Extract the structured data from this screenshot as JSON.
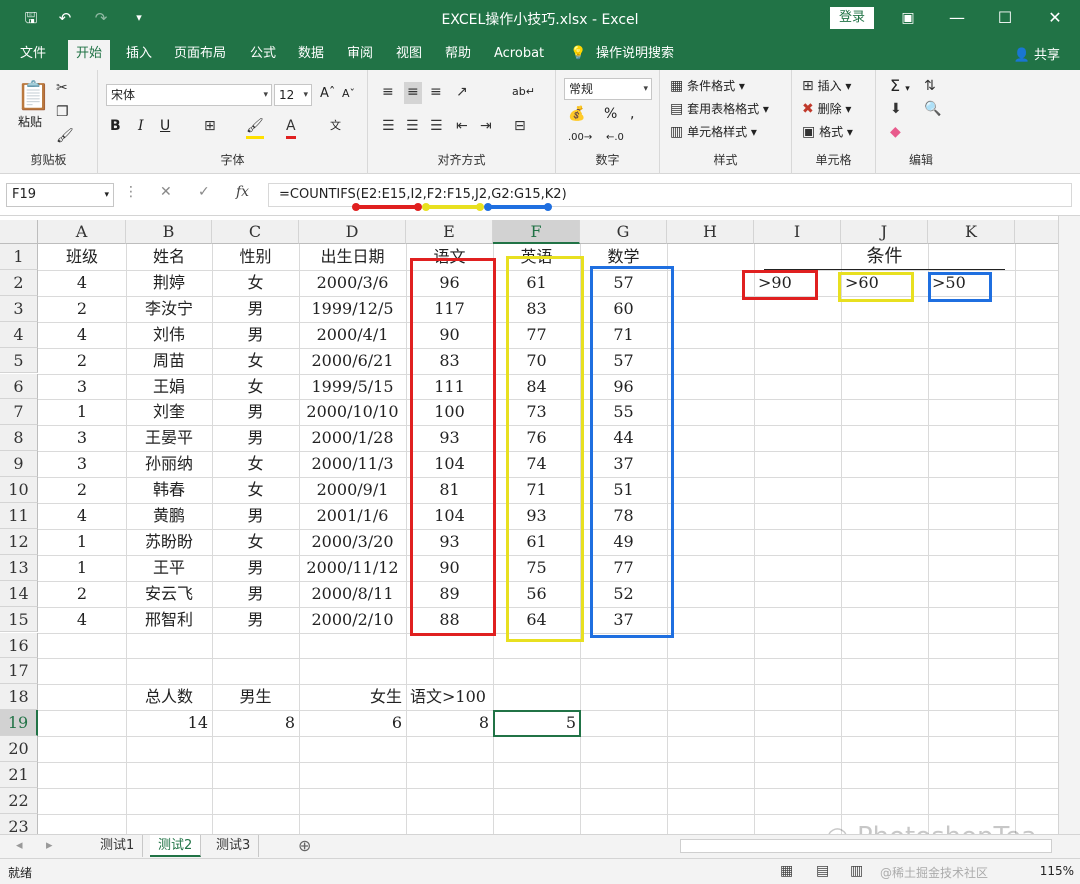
{
  "titlebar": {
    "title": "EXCEL操作小技巧.xlsx  -  Excel",
    "login": "登录",
    "icons": [
      "save-icon",
      "undo-icon",
      "redo-icon",
      "customize-icon"
    ]
  },
  "tabs": [
    "文件",
    "开始",
    "插入",
    "页面布局",
    "公式",
    "数据",
    "审阅",
    "视图",
    "帮助",
    "Acrobat"
  ],
  "active_tab": "开始",
  "tell_me": "操作说明搜索",
  "share": "共享",
  "ribbon": {
    "paste_label": "粘贴",
    "clipboard_label": "剪贴板",
    "font_name": "宋体",
    "font_size": "12",
    "font_label": "字体",
    "align_label": "对齐方式",
    "number_format": "常规",
    "number_label": "数字",
    "cond_format": "条件格式",
    "table_format": "套用表格格式",
    "cell_style": "单元格样式",
    "style_label": "样式",
    "insert": "插入",
    "delete": "删除",
    "format": "格式",
    "cells_label": "单元格",
    "edit_label": "编辑"
  },
  "formula_bar": {
    "name_box": "F19",
    "formula": "=COUNTIFS(E2:E15,I2,F2:F15,J2,G2:G15,K2)"
  },
  "columns": [
    "A",
    "B",
    "C",
    "D",
    "E",
    "F",
    "G",
    "H",
    "I",
    "J",
    "K"
  ],
  "rows": [
    "1",
    "2",
    "3",
    "4",
    "5",
    "6",
    "7",
    "8",
    "9",
    "10",
    "11",
    "12",
    "13",
    "14",
    "15",
    "16",
    "17",
    "18",
    "19",
    "20",
    "21",
    "22",
    "23"
  ],
  "headers": [
    "班级",
    "姓名",
    "性别",
    "出生日期",
    "语文",
    "英语",
    "数学"
  ],
  "table": [
    [
      "4",
      "荆婷",
      "女",
      "2000/3/6",
      "96",
      "61",
      "57"
    ],
    [
      "2",
      "李汝宁",
      "男",
      "1999/12/5",
      "117",
      "83",
      "60"
    ],
    [
      "4",
      "刘伟",
      "男",
      "2000/4/1",
      "90",
      "77",
      "71"
    ],
    [
      "2",
      "周苗",
      "女",
      "2000/6/21",
      "83",
      "70",
      "57"
    ],
    [
      "3",
      "王娟",
      "女",
      "1999/5/15",
      "111",
      "84",
      "96"
    ],
    [
      "1",
      "刘奎",
      "男",
      "2000/10/10",
      "100",
      "73",
      "55"
    ],
    [
      "3",
      "王晏平",
      "男",
      "2000/1/28",
      "93",
      "76",
      "44"
    ],
    [
      "3",
      "孙丽纳",
      "女",
      "2000/11/3",
      "104",
      "74",
      "37"
    ],
    [
      "2",
      "韩春",
      "女",
      "2000/9/1",
      "81",
      "71",
      "51"
    ],
    [
      "4",
      "黄鹏",
      "男",
      "2001/1/6",
      "104",
      "93",
      "78"
    ],
    [
      "1",
      "苏盼盼",
      "女",
      "2000/3/20",
      "93",
      "61",
      "49"
    ],
    [
      "1",
      "王平",
      "男",
      "2000/11/12",
      "90",
      "75",
      "77"
    ],
    [
      "2",
      "安云飞",
      "男",
      "2000/8/11",
      "89",
      "56",
      "52"
    ],
    [
      "4",
      "邢智利",
      "男",
      "2000/2/10",
      "88",
      "64",
      "37"
    ]
  ],
  "condition": {
    "title": "条件",
    "values": [
      ">90",
      ">60",
      ">50"
    ]
  },
  "summary": {
    "labels": [
      "总人数",
      "男生",
      "女生",
      "语文>100"
    ],
    "values": [
      "14",
      "8",
      "6",
      "8",
      "5"
    ]
  },
  "sheets": [
    "测试1",
    "测试2",
    "测试3"
  ],
  "active_sheet": "测试2",
  "status": {
    "ready": "就绪",
    "zoom": "115%"
  },
  "watermark": "PhotoshopTea",
  "watermark2": "@稀土掘金技术社区",
  "colors": {
    "excel_green": "#217346",
    "red": "#e02020",
    "yellow": "#e8e020",
    "blue": "#1f6fe0"
  }
}
